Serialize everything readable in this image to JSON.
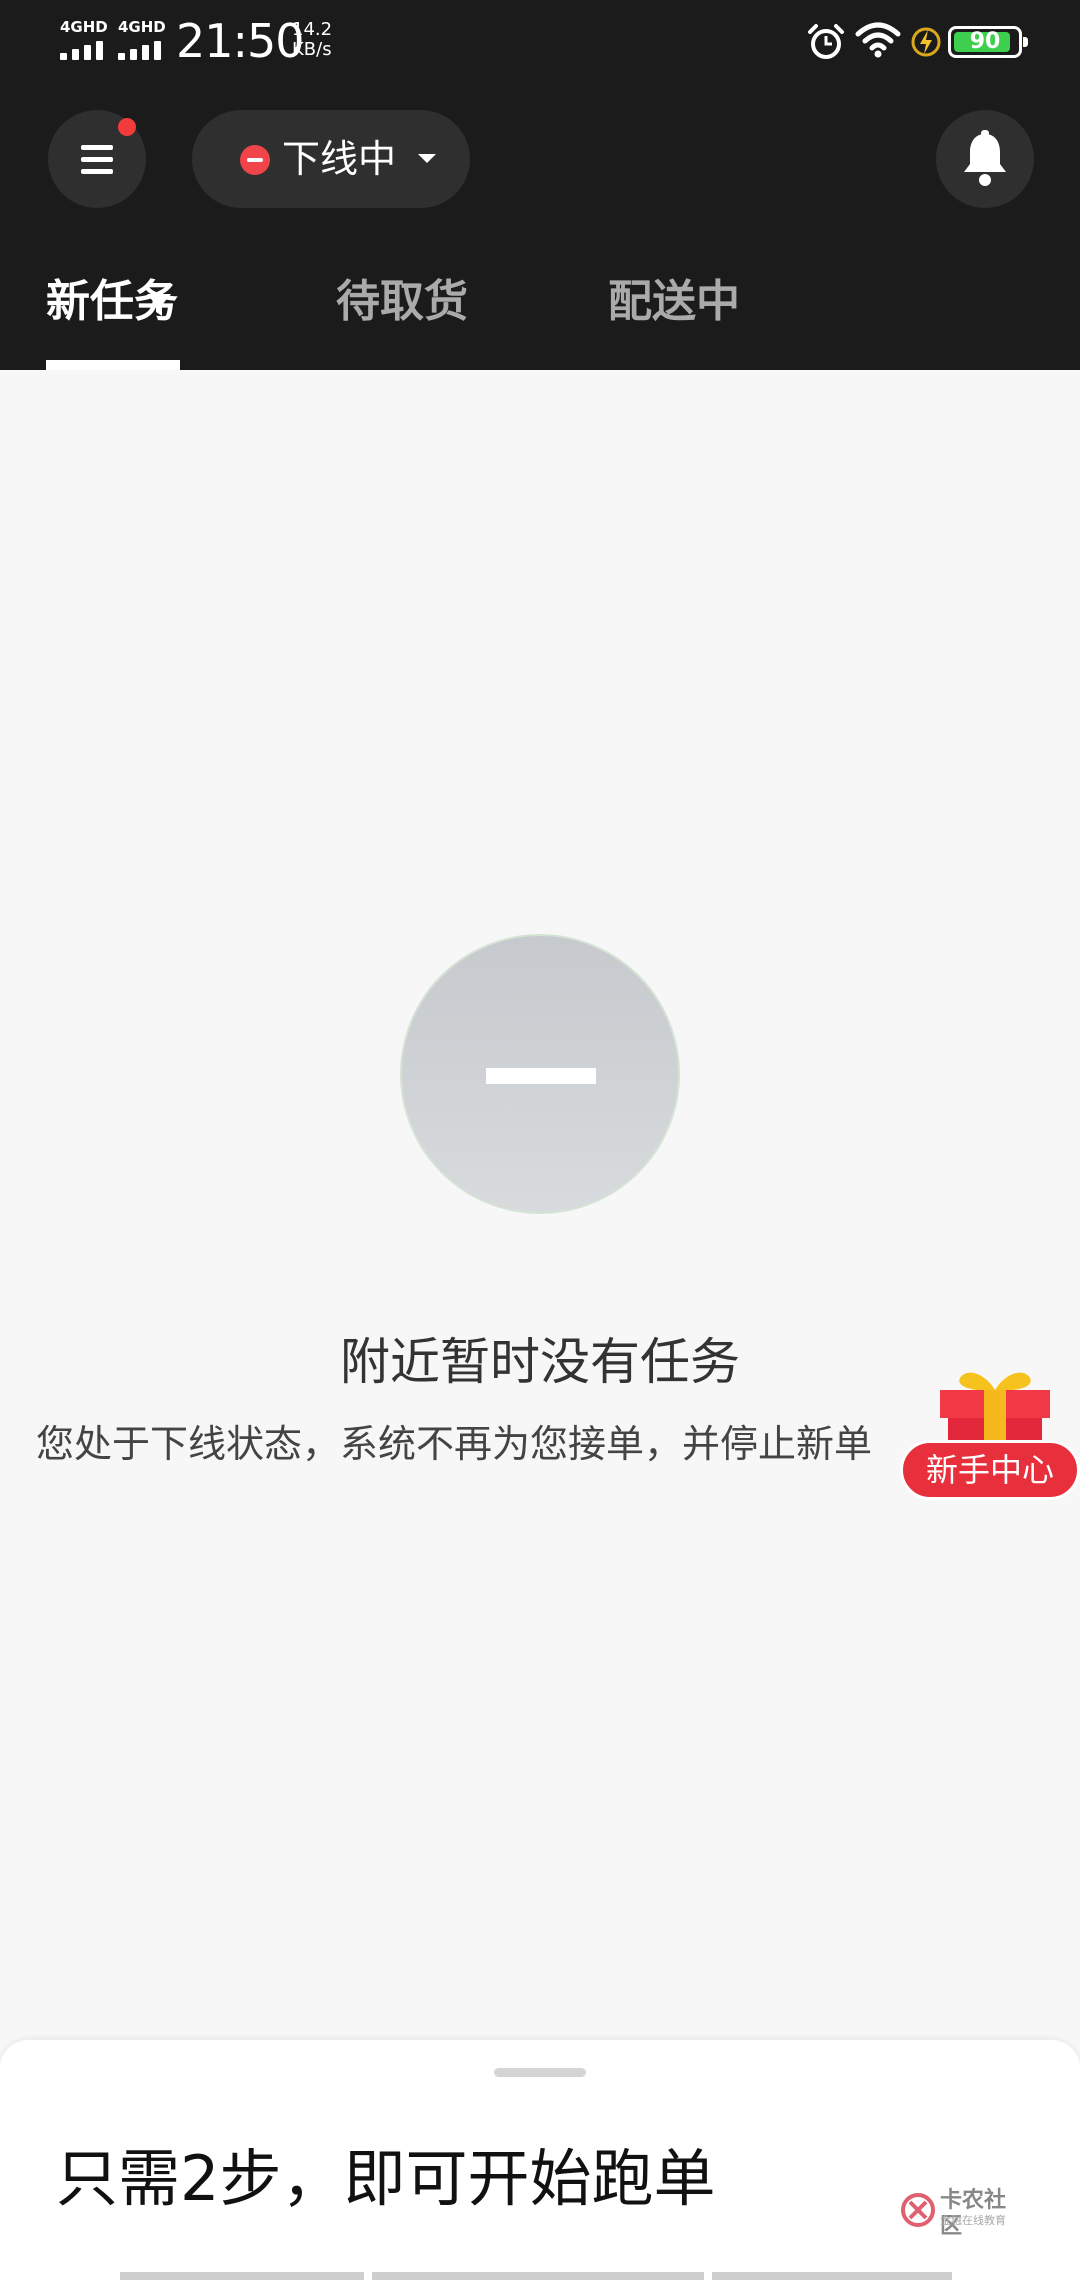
{
  "status_bar": {
    "signal1_label": "4GHD",
    "signal2_label": "4GHD",
    "time": "21:50",
    "net_speed_value": "14.2",
    "net_speed_unit": "KB/s",
    "battery_level": "90",
    "battery_fraction": 0.9,
    "battery_color": "#3ecf4f"
  },
  "header": {
    "menu_icon": "menu-icon",
    "menu_badge_color": "#f23b3b",
    "status_label": "下线中",
    "status_icon": "offline-icon",
    "bell_icon": "bell-icon",
    "tabs": [
      {
        "label": "新任务",
        "active": true
      },
      {
        "label": "待取货",
        "active": false
      },
      {
        "label": "配送中",
        "active": false
      }
    ],
    "filter_icon": "filter-icon"
  },
  "empty_state": {
    "icon": "empty-icon",
    "title": "附近暂时没有任务",
    "description": "您处于下线状态，系统不再为您接单，并停止新单"
  },
  "gift": {
    "icon": "gift-icon",
    "label": "新手中心"
  },
  "bottom_sheet": {
    "title": "只需2步，即可开始跑单",
    "watermark_title": "卡农社区",
    "watermark_subtitle": "金融在线教育"
  },
  "colors": {
    "header_bg": "#1b1b1b",
    "accent_red": "#e8303d",
    "page_bg": "#f7f7f7"
  }
}
